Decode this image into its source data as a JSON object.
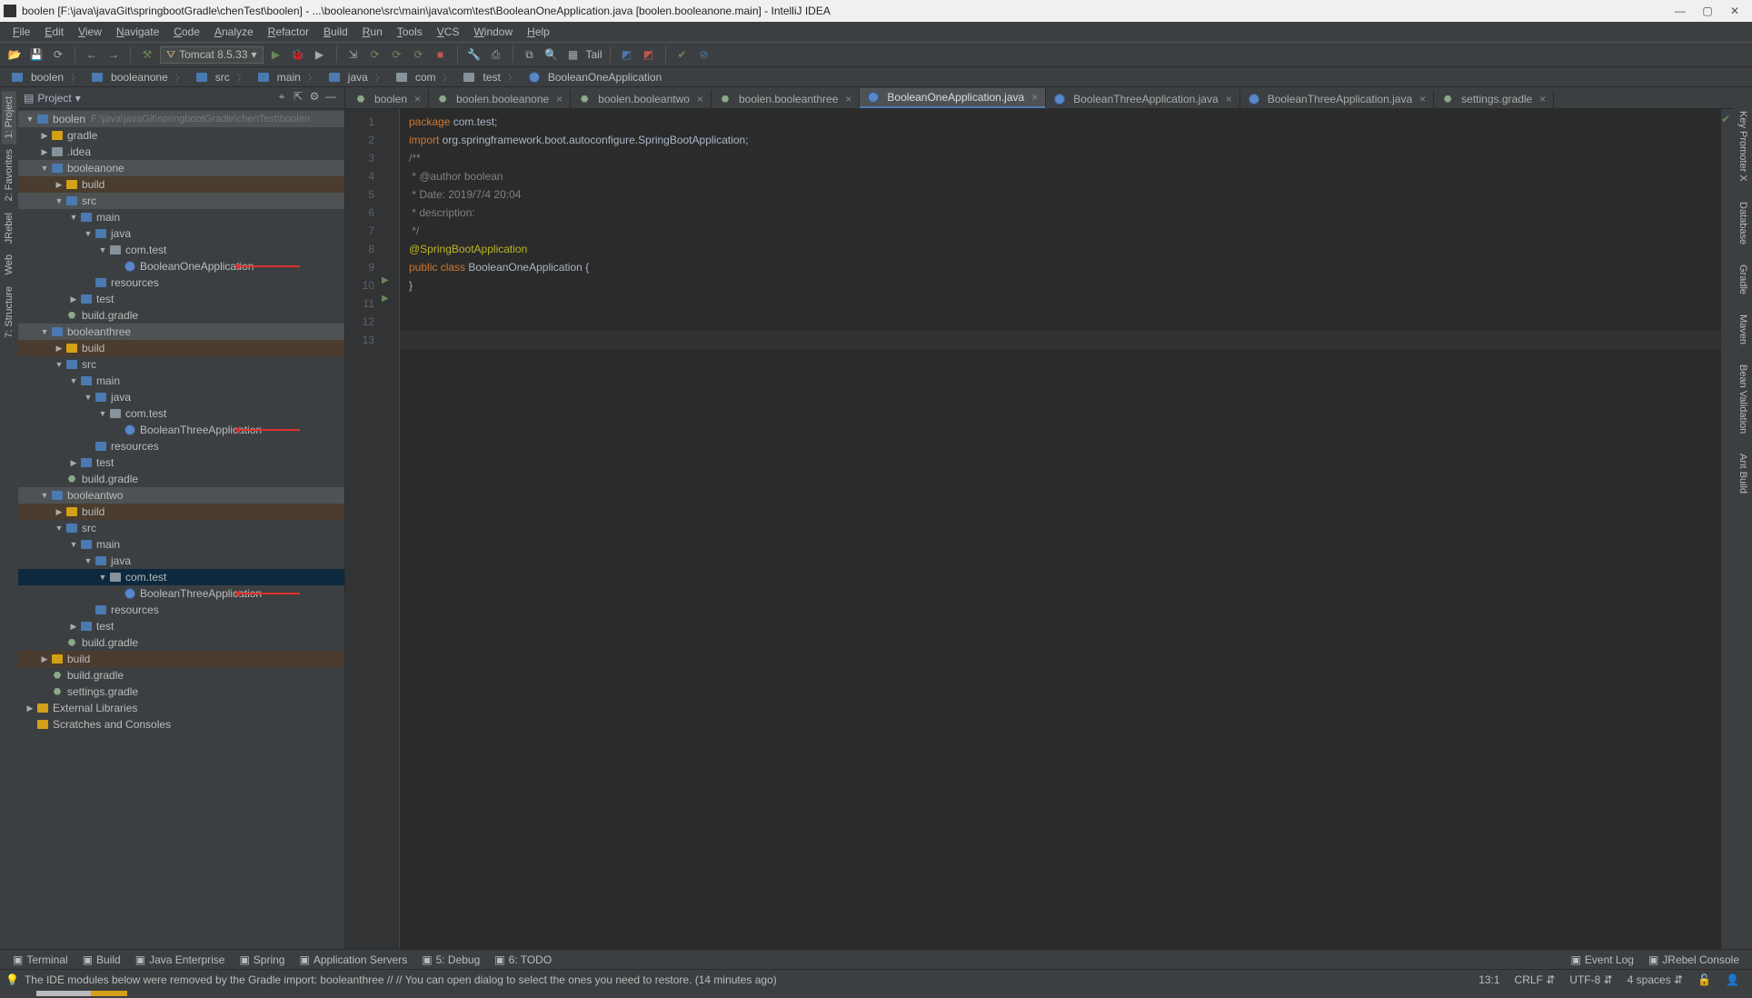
{
  "title": "boolen [F:\\java\\javaGit\\springbootGradle\\chenTest\\boolen] - ...\\booleanone\\src\\main\\java\\com\\test\\BooleanOneApplication.java [boolen.booleanone.main] - IntelliJ IDEA",
  "menu": [
    "File",
    "Edit",
    "View",
    "Navigate",
    "Code",
    "Analyze",
    "Refactor",
    "Build",
    "Run",
    "Tools",
    "VCS",
    "Window",
    "Help"
  ],
  "run_config": "Tomcat 8.5.33",
  "tail_label": "Tail",
  "breadcrumbs": [
    {
      "icon": "folder-blue",
      "label": "boolen"
    },
    {
      "icon": "folder-blue",
      "label": "booleanone"
    },
    {
      "icon": "folder-blue",
      "label": "src"
    },
    {
      "icon": "folder-blue",
      "label": "main"
    },
    {
      "icon": "folder-blue",
      "label": "java"
    },
    {
      "icon": "folder-gray",
      "label": "com"
    },
    {
      "icon": "folder-gray",
      "label": "test"
    },
    {
      "icon": "icon-class",
      "label": "BooleanOneApplication"
    }
  ],
  "panel": {
    "title": "Project"
  },
  "tree": [
    {
      "d": 0,
      "caret": "▼",
      "icon": "folder-blue",
      "label": "boolen",
      "path": "F:\\java\\javaGit\\springbootGradle\\chenTest\\boolen",
      "cls": "highlighted"
    },
    {
      "d": 1,
      "caret": "▶",
      "icon": "folder-yellow",
      "label": "gradle"
    },
    {
      "d": 1,
      "caret": "▶",
      "icon": "folder-gray",
      "label": ".idea"
    },
    {
      "d": 1,
      "caret": "▼",
      "icon": "folder-blue",
      "label": "booleanone",
      "cls": "highlighted"
    },
    {
      "d": 2,
      "caret": "▶",
      "icon": "folder-yellow",
      "label": "build",
      "cls": "highlighted-orange"
    },
    {
      "d": 2,
      "caret": "▼",
      "icon": "folder-blue",
      "label": "src",
      "cls": "highlighted"
    },
    {
      "d": 3,
      "caret": "▼",
      "icon": "folder-blue",
      "label": "main"
    },
    {
      "d": 4,
      "caret": "▼",
      "icon": "folder-blue",
      "label": "java"
    },
    {
      "d": 5,
      "caret": "▼",
      "icon": "folder-gray",
      "label": "com.test"
    },
    {
      "d": 6,
      "caret": "",
      "icon": "icon-class",
      "label": "BooleanOneApplication",
      "arrow": true
    },
    {
      "d": 4,
      "caret": "",
      "icon": "folder-blue",
      "label": "resources"
    },
    {
      "d": 3,
      "caret": "▶",
      "icon": "folder-blue",
      "label": "test"
    },
    {
      "d": 2,
      "caret": "",
      "icon": "icon-gradle",
      "label": "build.gradle"
    },
    {
      "d": 1,
      "caret": "▼",
      "icon": "folder-blue",
      "label": "booleanthree",
      "cls": "highlighted"
    },
    {
      "d": 2,
      "caret": "▶",
      "icon": "folder-yellow",
      "label": "build",
      "cls": "highlighted-orange"
    },
    {
      "d": 2,
      "caret": "▼",
      "icon": "folder-blue",
      "label": "src"
    },
    {
      "d": 3,
      "caret": "▼",
      "icon": "folder-blue",
      "label": "main"
    },
    {
      "d": 4,
      "caret": "▼",
      "icon": "folder-blue",
      "label": "java"
    },
    {
      "d": 5,
      "caret": "▼",
      "icon": "folder-gray",
      "label": "com.test"
    },
    {
      "d": 6,
      "caret": "",
      "icon": "icon-class",
      "label": "BooleanThreeApplication",
      "arrow": true
    },
    {
      "d": 4,
      "caret": "",
      "icon": "folder-blue",
      "label": "resources"
    },
    {
      "d": 3,
      "caret": "▶",
      "icon": "folder-blue",
      "label": "test"
    },
    {
      "d": 2,
      "caret": "",
      "icon": "icon-gradle",
      "label": "build.gradle"
    },
    {
      "d": 1,
      "caret": "▼",
      "icon": "folder-blue",
      "label": "booleantwo",
      "cls": "highlighted"
    },
    {
      "d": 2,
      "caret": "▶",
      "icon": "folder-yellow",
      "label": "build",
      "cls": "highlighted-orange"
    },
    {
      "d": 2,
      "caret": "▼",
      "icon": "folder-blue",
      "label": "src"
    },
    {
      "d": 3,
      "caret": "▼",
      "icon": "folder-blue",
      "label": "main"
    },
    {
      "d": 4,
      "caret": "▼",
      "icon": "folder-blue",
      "label": "java"
    },
    {
      "d": 5,
      "caret": "▼",
      "icon": "folder-gray",
      "label": "com.test",
      "cls": "sel"
    },
    {
      "d": 6,
      "caret": "",
      "icon": "icon-class",
      "label": "BooleanThreeApplication",
      "arrow": true
    },
    {
      "d": 4,
      "caret": "",
      "icon": "folder-blue",
      "label": "resources"
    },
    {
      "d": 3,
      "caret": "▶",
      "icon": "folder-blue",
      "label": "test"
    },
    {
      "d": 2,
      "caret": "",
      "icon": "icon-gradle",
      "label": "build.gradle"
    },
    {
      "d": 1,
      "caret": "▶",
      "icon": "folder-yellow",
      "label": "build",
      "cls": "highlighted-orange"
    },
    {
      "d": 1,
      "caret": "",
      "icon": "icon-gradle",
      "label": "build.gradle"
    },
    {
      "d": 1,
      "caret": "",
      "icon": "icon-gradle",
      "label": "settings.gradle"
    },
    {
      "d": 0,
      "caret": "▶",
      "icon": "folder-yellow",
      "label": "External Libraries"
    },
    {
      "d": 0,
      "caret": "",
      "icon": "folder-yellow",
      "label": "Scratches and Consoles"
    }
  ],
  "editor_tabs": [
    {
      "icon": "icon-gradle",
      "label": "boolen"
    },
    {
      "icon": "icon-gradle",
      "label": "boolen.booleanone"
    },
    {
      "icon": "icon-gradle",
      "label": "boolen.booleantwo"
    },
    {
      "icon": "icon-gradle",
      "label": "boolen.booleanthree"
    },
    {
      "icon": "icon-class",
      "label": "BooleanOneApplication.java",
      "active": true
    },
    {
      "icon": "icon-class",
      "label": "BooleanThreeApplication.java"
    },
    {
      "icon": "icon-class",
      "label": "BooleanThreeApplication.java"
    },
    {
      "icon": "icon-gradle",
      "label": "settings.gradle"
    }
  ],
  "code": {
    "lines": [
      "package com.test;",
      "",
      "import org.springframework.boot.autoconfigure.SpringBootApplication;",
      "",
      "/**",
      " * @author boolean",
      " * Date: 2019/7/4 20:04",
      " * description:",
      " */",
      "@SpringBootApplication",
      "public class BooleanOneApplication {",
      "}",
      ""
    ],
    "cursor_line": 13
  },
  "left_tabs": [
    "1: Project",
    "2: Favorites",
    "JRebel",
    "Web",
    "7: Structure"
  ],
  "right_tabs": [
    "Key Promoter X",
    "Database",
    "Gradle",
    "Maven",
    "Bean Validation",
    "Ant Build"
  ],
  "bottom_tabs": [
    "Terminal",
    "Build",
    "Java Enterprise",
    "Spring",
    "Application Servers",
    "5: Debug",
    "6: TODO"
  ],
  "bottom_right": [
    "Event Log",
    "JRebel Console"
  ],
  "status": {
    "msg": "The IDE modules below were removed by the Gradle import: booleanthree // // You can open dialog to select the ones you need to restore. (14 minutes ago)",
    "pos": "13:1",
    "eol": "CRLF",
    "enc": "UTF-8",
    "indent": "4 spaces"
  }
}
